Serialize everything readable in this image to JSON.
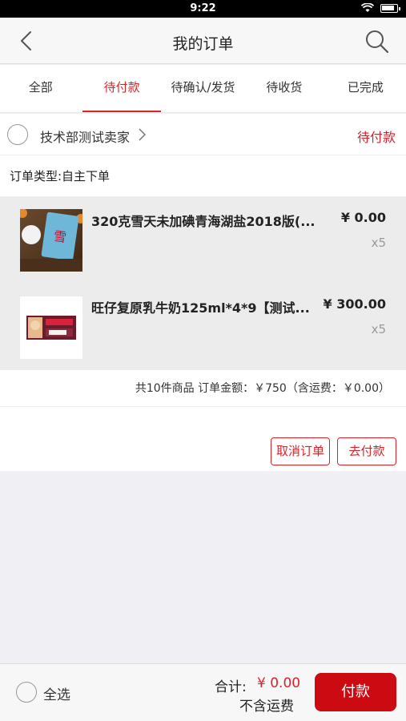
{
  "status_bar": {
    "time": "9:22"
  },
  "header": {
    "title": "我的订单"
  },
  "tabs": [
    {
      "label": "全部"
    },
    {
      "label": "待付款"
    },
    {
      "label": "待确认/发货"
    },
    {
      "label": "待收货"
    },
    {
      "label": "已完成"
    }
  ],
  "active_tab": "待付款",
  "order": {
    "shop_name": "技术部测试卖家",
    "status": "待付款",
    "order_type": "订单类型:自主下单",
    "items": [
      {
        "name": "320克雪天未加碘青海湖盐2018版(...",
        "price": "¥ 0.00",
        "qty": "x5"
      },
      {
        "name": "旺仔复原乳牛奶125ml*4*9【测试...",
        "price": "¥ 300.00",
        "qty": "x5"
      }
    ],
    "summary": "共10件商品 订单金额：￥750（含运费：￥0.00）",
    "cancel_label": "取消订单",
    "pay_label": "去付款"
  },
  "footer": {
    "select_all_label": "全选",
    "total_label": "合计:",
    "total_value": "¥ 0.00",
    "shipping_note": "不含运费",
    "checkout_label": "付款"
  },
  "colors": {
    "accent": "#d9222a",
    "checkout": "#cc0a12"
  }
}
